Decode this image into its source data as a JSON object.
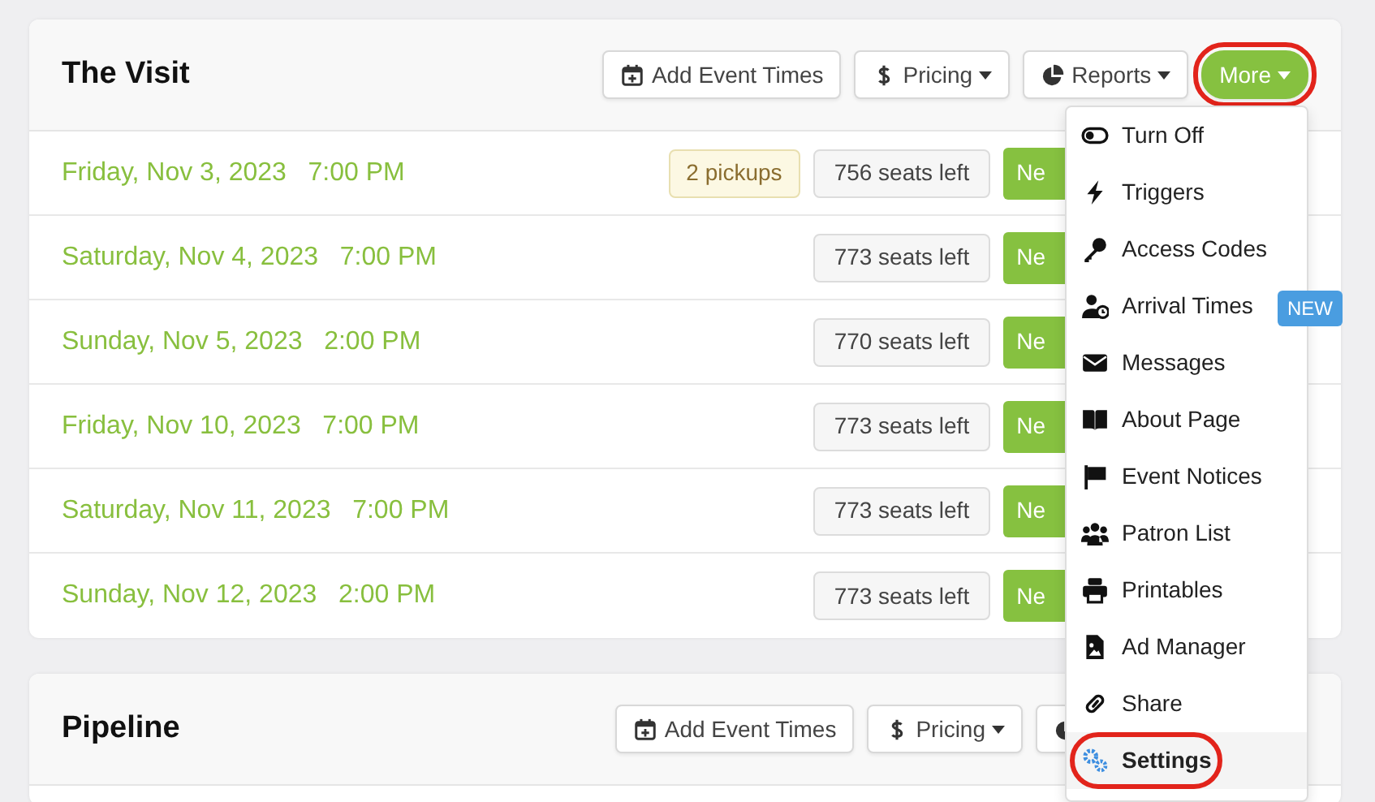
{
  "events": [
    {
      "title": "The Visit",
      "actions": [
        {
          "kind": "calendar",
          "label": "Add Event Times",
          "caret": false,
          "highlighted": false
        },
        {
          "kind": "dollar",
          "label": "Pricing",
          "caret": true,
          "highlighted": false
        },
        {
          "kind": "pie",
          "label": "Reports",
          "caret": true,
          "highlighted": false
        },
        {
          "kind": "more",
          "label": "More",
          "caret": true,
          "highlighted": true
        }
      ],
      "times": [
        {
          "date": "Friday, Nov 3, 2023",
          "time": "7:00 PM",
          "pickups": "2 pickups",
          "seats": "756 seats left",
          "button": "Ne"
        },
        {
          "date": "Saturday, Nov 4, 2023",
          "time": "7:00 PM",
          "seats": "773 seats left",
          "button": "Ne"
        },
        {
          "date": "Sunday, Nov 5, 2023",
          "time": "2:00 PM",
          "seats": "770 seats left",
          "button": "Ne"
        },
        {
          "date": "Friday, Nov 10, 2023",
          "time": "7:00 PM",
          "seats": "773 seats left",
          "button": "Ne"
        },
        {
          "date": "Saturday, Nov 11, 2023",
          "time": "7:00 PM",
          "seats": "773 seats left",
          "button": "Ne"
        },
        {
          "date": "Sunday, Nov 12, 2023",
          "time": "2:00 PM",
          "seats": "773 seats left",
          "button": "Ne"
        }
      ]
    },
    {
      "title": "Pipeline",
      "actions": [
        {
          "kind": "calendar",
          "label": "Add Event Times",
          "caret": false
        },
        {
          "kind": "dollar",
          "label": "Pricing",
          "caret": true
        },
        {
          "kind": "pie",
          "caret": false
        }
      ]
    }
  ],
  "menu": {
    "items": [
      {
        "kind": "toggle",
        "label": "Turn Off",
        "highlighted": false
      },
      {
        "kind": "bolt",
        "label": "Triggers",
        "highlighted": false
      },
      {
        "kind": "key",
        "label": "Access Codes",
        "highlighted": false
      },
      {
        "kind": "user-clock",
        "label": "Arrival Times",
        "badge": "NEW",
        "highlighted": false
      },
      {
        "kind": "envelope",
        "label": "Messages",
        "highlighted": false
      },
      {
        "kind": "book",
        "label": "About Page",
        "highlighted": false
      },
      {
        "kind": "flag",
        "label": "Event Notices",
        "highlighted": false
      },
      {
        "kind": "users",
        "label": "Patron List",
        "highlighted": false
      },
      {
        "kind": "printer",
        "label": "Printables",
        "highlighted": false
      },
      {
        "kind": "file-image",
        "label": "Ad Manager",
        "highlighted": false
      },
      {
        "kind": "link",
        "label": "Share",
        "highlighted": false
      },
      {
        "kind": "gears",
        "label": "Settings",
        "highlighted": true
      }
    ]
  }
}
